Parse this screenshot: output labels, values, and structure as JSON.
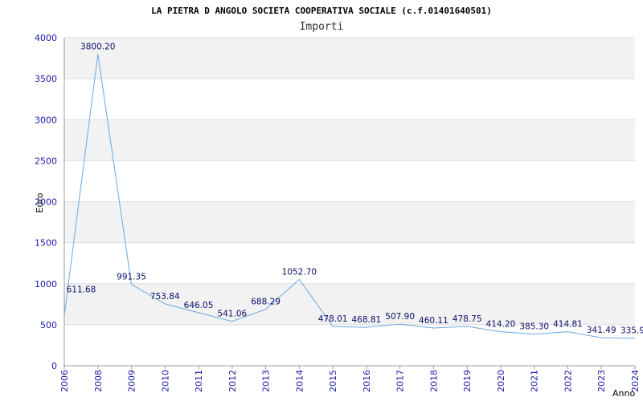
{
  "chart_data": {
    "type": "line",
    "title": "LA PIETRA D ANGOLO SOCIETA COOPERATIVA SOCIALE (c.f.01401640501)",
    "subtitle": "Importi",
    "xlabel": "Anno",
    "ylabel": "Euro",
    "ylim": [
      0,
      4000
    ],
    "yticks": [
      "0",
      "500",
      "1000",
      "1500",
      "2000",
      "2500",
      "3000",
      "3500",
      "4000"
    ],
    "grid": true,
    "colors": {
      "line": "#6aa8e0",
      "band": "#f2f2f2",
      "gridline": "#dddddd"
    },
    "x": [
      "2006",
      "2008",
      "2009",
      "2010",
      "2011",
      "2012",
      "2013",
      "2014",
      "2015",
      "2016",
      "2017",
      "2018",
      "2019",
      "2020",
      "2021",
      "2022",
      "2023",
      "2024"
    ],
    "series": [
      {
        "values": [
          611.68,
          3800.2,
          991.35,
          753.84,
          646.05,
          541.06,
          688.29,
          1052.7,
          478.01,
          468.81,
          507.9,
          460.11,
          478.75,
          414.2,
          385.3,
          414.81,
          341.49,
          335.9
        ],
        "labels": [
          "611.68",
          "3800.20",
          "991.35",
          "753.84",
          "646.05",
          "541.06",
          "688.29",
          "1052.70",
          "478.01",
          "468.81",
          "507.90",
          "460.11",
          "478.75",
          "414.20",
          "385.30",
          "414.81",
          "341.49",
          "335.9"
        ]
      }
    ]
  }
}
